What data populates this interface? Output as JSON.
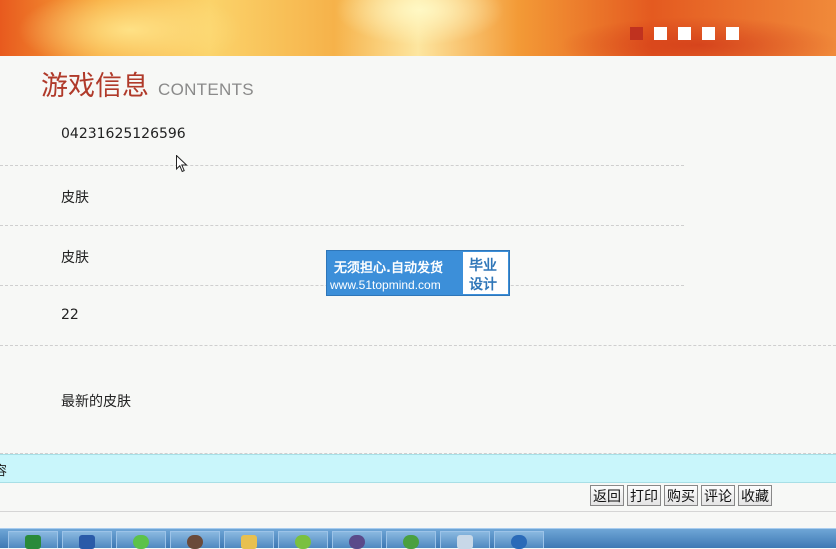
{
  "header": {
    "slides": 5,
    "active_slide": 0
  },
  "heading": {
    "title_cn": "游戏信息",
    "title_en": "CONTENTS"
  },
  "fields": {
    "id": "04231625126596",
    "name": "皮肤",
    "category": "皮肤",
    "price": "22",
    "description": "最新的皮肤"
  },
  "watermark": {
    "line1": "无须担心.自动发货",
    "line2": "www.51topmind.com",
    "badge_line1": "毕业",
    "badge_line2": "设计"
  },
  "cyan_bar_text": "容",
  "actions": {
    "back": "返回",
    "print": "打印",
    "buy": "购买",
    "comment": "评论",
    "favorite": "收藏"
  },
  "colors": {
    "title": "#b03a2a",
    "accent_dot": "#c0321f",
    "cyan_bar": "#c9f6fb",
    "watermark": "#3c8fd9"
  },
  "taskbar_icons": [
    "excel-icon",
    "word-icon",
    "wechat-icon",
    "avatar-icon",
    "folder-icon",
    "browser-icon",
    "eclipse-icon",
    "update-icon",
    "window-icon",
    "app-icon"
  ]
}
